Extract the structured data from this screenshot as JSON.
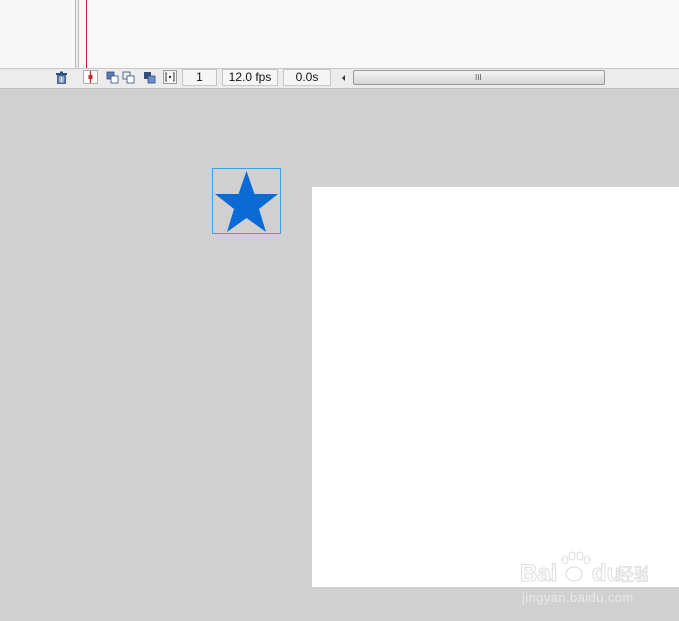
{
  "timeline": {
    "frame_number": "1",
    "frame_rate": "12.0 fps",
    "elapsed_time": "0.0s",
    "scroll_grip": "III"
  },
  "icons": {
    "delete_layer": "trash-icon",
    "playhead_marker": "playhead-icon",
    "center_frame": "center-frame-icon",
    "onion_skin": "onion-skin-icon",
    "onion_outline": "onion-skin-outlines-icon",
    "edit_multiple": "edit-multiple-frames-icon",
    "modify_markers": "modify-onion-markers-icon",
    "scroll_left": "scroll-left-arrow-icon"
  },
  "stage": {
    "star_color": "#0b6bd6",
    "selection_color": "#3aa0e8",
    "stage_color": "#ffffff",
    "pasteboard_color": "#d0d0d0"
  },
  "watermark": {
    "brand": "Bai du 经验",
    "url": "jingyan.baidu.com"
  }
}
